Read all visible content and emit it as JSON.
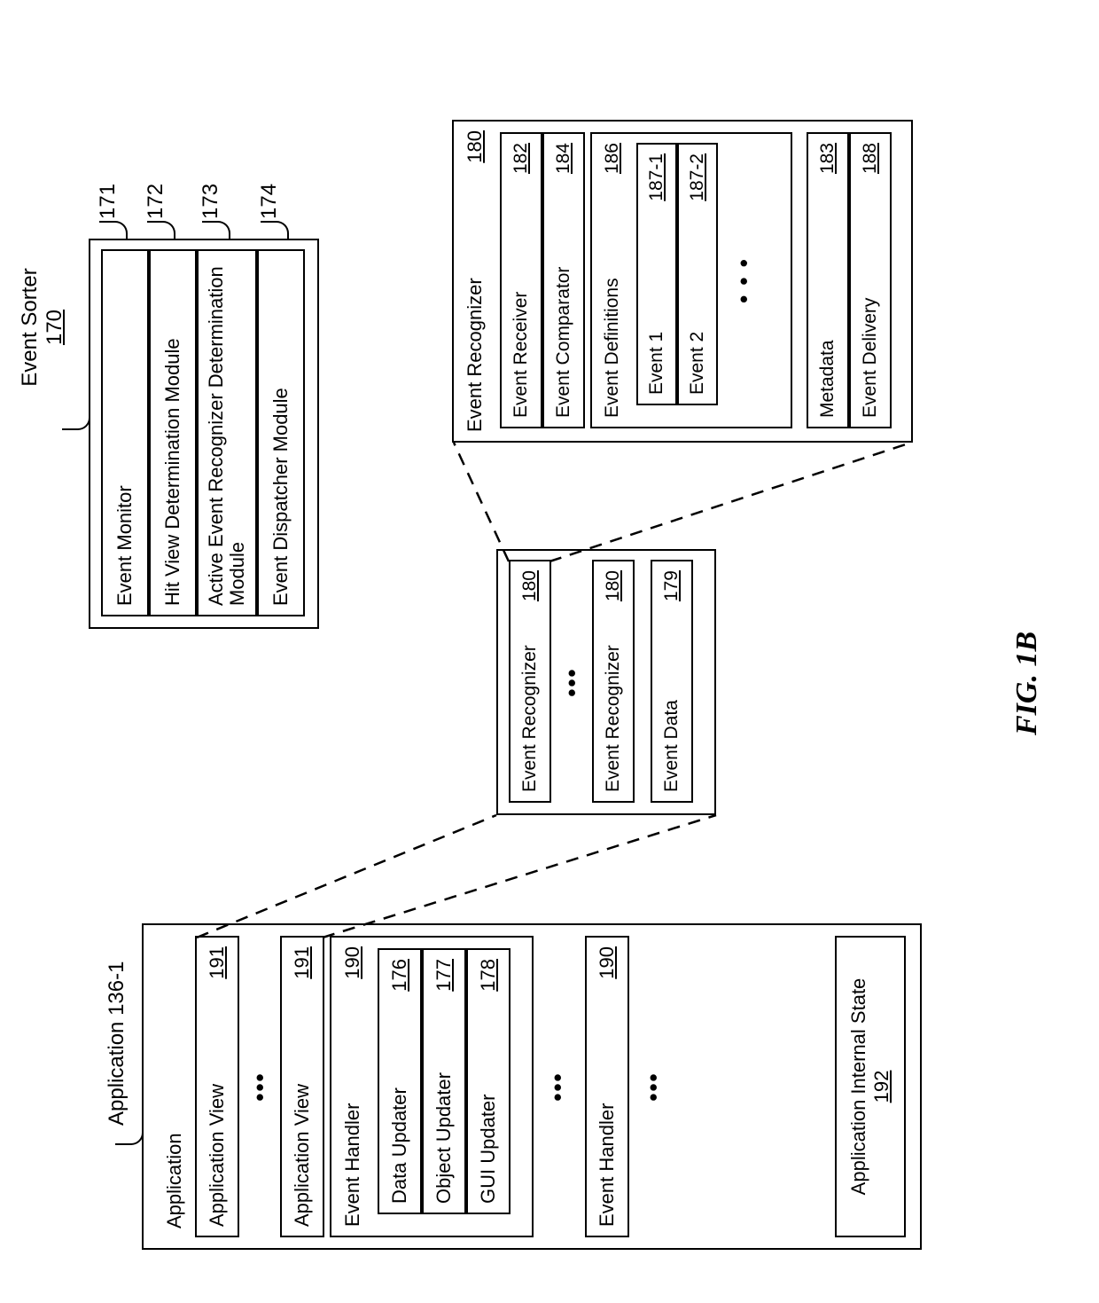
{
  "figure_label": "FIG. 1B",
  "event_sorter": {
    "title": "Event Sorter",
    "ref": "170",
    "rows": [
      {
        "label": "Event Monitor",
        "ref": "171"
      },
      {
        "label": "Hit View Determination Module",
        "ref": "172"
      },
      {
        "label": "Active Event Recognizer Determination Module",
        "ref": "173"
      },
      {
        "label": "Event Dispatcher Module",
        "ref": "174"
      }
    ]
  },
  "application": {
    "callout": "Application 136-1",
    "header": "Application",
    "app_view": {
      "label": "Application View",
      "ref": "191"
    },
    "event_handler": {
      "label": "Event Handler",
      "ref": "190",
      "rows": [
        {
          "label": "Data Updater",
          "ref": "176"
        },
        {
          "label": "Object Updater",
          "ref": "177"
        },
        {
          "label": "GUI Updater",
          "ref": "178"
        }
      ]
    },
    "internal_state": {
      "label": "Application Internal State",
      "ref": "192"
    }
  },
  "recognizer_group": {
    "row_label": "Event Recognizer",
    "row_ref": "180",
    "event_data": {
      "label": "Event Data",
      "ref": "179"
    }
  },
  "recognizer_detail": {
    "header": {
      "label": "Event Recognizer",
      "ref": "180"
    },
    "rows_top": [
      {
        "label": "Event Receiver",
        "ref": "182"
      },
      {
        "label": "Event Comparator",
        "ref": "184"
      }
    ],
    "definitions": {
      "label": "Event Definitions",
      "ref": "186",
      "events": [
        {
          "label": "Event 1",
          "ref": "187-1"
        },
        {
          "label": "Event 2",
          "ref": "187-2"
        }
      ]
    },
    "rows_bottom": [
      {
        "label": "Metadata",
        "ref": "183"
      },
      {
        "label": "Event Delivery",
        "ref": "188"
      }
    ]
  }
}
